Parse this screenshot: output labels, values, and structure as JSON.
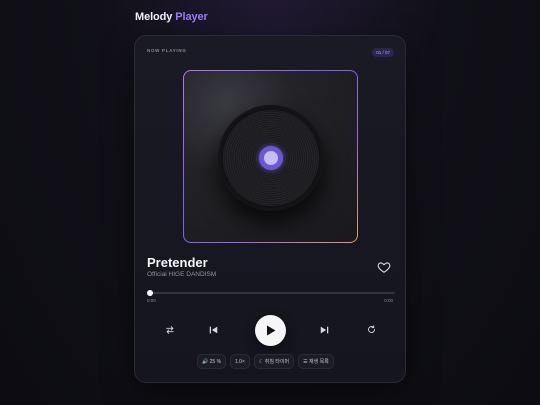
{
  "app": {
    "title_part1": "Melody",
    "title_part2": "Player"
  },
  "player": {
    "section_label": "NOW PLAYING",
    "track_counter": "01 / 07",
    "song_title": "Pretender",
    "artist": "Official HIGE DANDISM",
    "progress_fraction": 0.0,
    "time_current": "0:00",
    "time_total": "0:00",
    "liked": false
  },
  "controls": {
    "shuffle_icon": "shuffle-icon",
    "prev_icon": "skip-previous-icon",
    "play_icon": "play-icon",
    "next_icon": "skip-next-icon",
    "repeat_icon": "repeat-icon"
  },
  "chips": {
    "volume": "🔊 25 %",
    "speed": "1.0×",
    "sleep_timer": "☾ 취침 타이머",
    "playlist": "☰ 재생 목록"
  },
  "colors": {
    "accent": "#9b7dff",
    "background": "#0c0c12",
    "card": "#171720"
  }
}
